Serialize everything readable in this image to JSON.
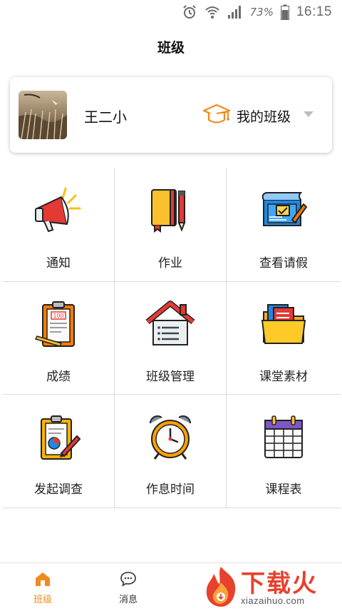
{
  "status_bar": {
    "battery_percent": "73%",
    "time": "16:15",
    "icons": [
      "alarm-icon",
      "wifi-icon",
      "signal-icon",
      "battery-icon"
    ]
  },
  "header": {
    "title": "班级"
  },
  "class_card": {
    "class_name": "王二小",
    "my_class_label": "我的班级"
  },
  "menu": [
    {
      "label": "通知",
      "icon": "megaphone-icon"
    },
    {
      "label": "作业",
      "icon": "notebook-icon"
    },
    {
      "label": "查看请假",
      "icon": "blueprint-icon"
    },
    {
      "label": "成绩",
      "icon": "clipboard-score-icon"
    },
    {
      "label": "班级管理",
      "icon": "house-icon"
    },
    {
      "label": "课堂素材",
      "icon": "folder-icon"
    },
    {
      "label": "发起调查",
      "icon": "survey-icon"
    },
    {
      "label": "作息时间",
      "icon": "alarm-clock-icon"
    },
    {
      "label": "课程表",
      "icon": "calendar-icon"
    }
  ],
  "tab_bar": {
    "tabs": [
      {
        "label": "班级",
        "icon": "home-icon",
        "active": true
      },
      {
        "label": "消息",
        "icon": "chat-icon",
        "active": false
      }
    ]
  },
  "watermark": {
    "text": "下载火",
    "url": "xiazaihuo.com"
  },
  "colors": {
    "accent": "#f18a1b",
    "brand_red": "#e8412c"
  }
}
